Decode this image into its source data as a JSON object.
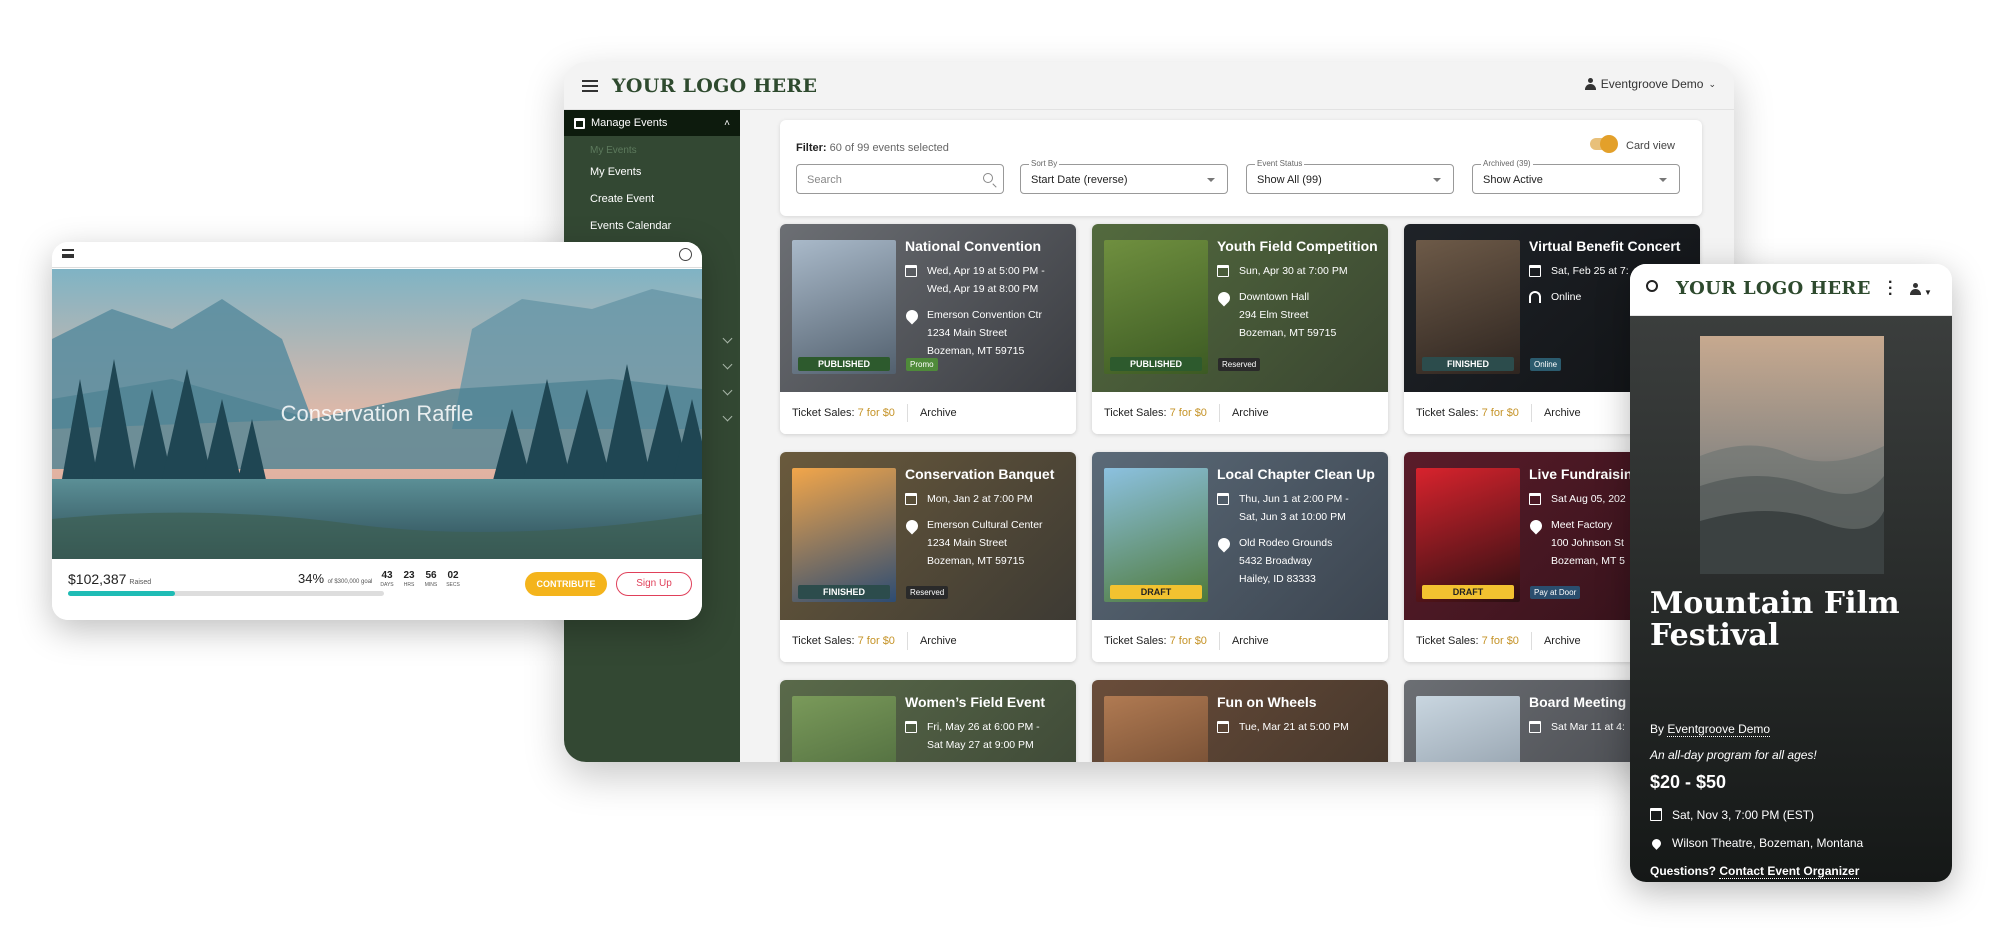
{
  "desktop": {
    "logo": "YOUR LOGO HERE",
    "user": "Eventgroove Demo",
    "sidebar": {
      "header": "Manage Events",
      "ghost_item": "My Events",
      "items": [
        "My Events",
        "Create Event",
        "Events Calendar"
      ]
    },
    "filter": {
      "label": "Filter:",
      "summary": "60 of 99 events selected",
      "card_view_label": "Card view",
      "search_placeholder": "Search",
      "sort_by": {
        "label": "Sort By",
        "value": "Start Date (reverse)"
      },
      "event_status": {
        "label": "Event Status",
        "value": "Show All (99)"
      },
      "archived": {
        "label": "Archived (39)",
        "value": "Show Active"
      }
    },
    "cards": [
      {
        "title": "National Convention",
        "date1": "Wed, Apr 19 at 5:00 PM -",
        "date2": "Wed, Apr 19 at 8:00 PM",
        "loc1": "Emerson Convention Ctr",
        "loc2": "1234 Main Street",
        "loc3": "Bozeman, MT 59715",
        "status": "PUBLISHED",
        "tag": "Promo",
        "tickets_label": "Ticket Sales:",
        "tickets_value": "7 for $0",
        "archive": "Archive"
      },
      {
        "title": "Youth Field Competition",
        "date1": "Sun, Apr 30 at 7:00 PM",
        "date2": "",
        "loc1": "Downtown Hall",
        "loc2": "294 Elm Street",
        "loc3": "Bozeman, MT 59715",
        "status": "PUBLISHED",
        "tag": "Reserved",
        "tickets_label": "Ticket Sales:",
        "tickets_value": "7 for $0",
        "archive": "Archive"
      },
      {
        "title": "Virtual Benefit Concert",
        "date1": "Sat, Feb 25 at 7:",
        "date2": "",
        "loc1": "Online",
        "loc2": "",
        "loc3": "",
        "status": "FINISHED",
        "tag": "Online",
        "tickets_label": "Ticket Sales:",
        "tickets_value": "7 for $0",
        "archive": "Archive"
      },
      {
        "title": "Conservation Banquet",
        "date1": "Mon, Jan 2 at 7:00 PM",
        "date2": "",
        "loc1": "Emerson Cultural Center",
        "loc2": "1234 Main Street",
        "loc3": "Bozeman, MT 59715",
        "status": "FINISHED",
        "tag": "Reserved",
        "tickets_label": "Ticket Sales:",
        "tickets_value": "7 for $0",
        "archive": "Archive"
      },
      {
        "title": "Local Chapter Clean Up",
        "date1": "Thu, Jun 1 at 2:00 PM -",
        "date2": "Sat, Jun 3 at 10:00 PM",
        "loc1": "Old Rodeo Grounds",
        "loc2": "5432 Broadway",
        "loc3": "Hailey, ID 83333",
        "status": "DRAFT",
        "tag": "",
        "tickets_label": "Ticket Sales:",
        "tickets_value": "7 for $0",
        "archive": "Archive"
      },
      {
        "title": "Live Fundraising",
        "date1": "Sat Aug 05, 202",
        "date2": "",
        "loc1": "Meet Factory",
        "loc2": "100 Johnson St",
        "loc3": "Bozeman, MT 5",
        "status": "DRAFT",
        "tag": "Pay at Door",
        "tickets_label": "Ticket Sales:",
        "tickets_value": "7 for $0",
        "archive": "Archive"
      },
      {
        "title": "Women’s Field Event",
        "date1": "Fri, May 26 at 6:00 PM -",
        "date2": "Sat May 27 at 9:00 PM",
        "loc1": "",
        "loc2": "",
        "loc3": "",
        "status": "",
        "tag": "",
        "tickets_label": "",
        "tickets_value": "",
        "archive": ""
      },
      {
        "title": "Fun on Wheels",
        "date1": "Tue, Mar 21 at 5:00 PM",
        "date2": "",
        "loc1": "",
        "loc2": "",
        "loc3": "",
        "status": "",
        "tag": "",
        "tickets_label": "",
        "tickets_value": "",
        "archive": ""
      },
      {
        "title": "Board Meeting",
        "date1": "Sat Mar 11 at 4:",
        "date2": "",
        "loc1": "",
        "loc2": "",
        "loc3": "",
        "status": "",
        "tag": "",
        "tickets_label": "",
        "tickets_value": "",
        "archive": ""
      }
    ]
  },
  "tablet": {
    "hero_title": "Conservation Raffle",
    "raised_amount": "$102,387",
    "raised_label": "Raised",
    "progress_percent": 34,
    "percent_text": "34%",
    "goal_text": "of $300,000 goal",
    "countdown": [
      {
        "value": "43",
        "unit": "DAYS"
      },
      {
        "value": "23",
        "unit": "HRS"
      },
      {
        "value": "56",
        "unit": "MINS"
      },
      {
        "value": "02",
        "unit": "SECS"
      }
    ],
    "contribute_label": "CONTRIBUTE",
    "signup_label": "Sign Up"
  },
  "phone": {
    "logo": "YOUR LOGO HERE",
    "title": "Mountain Film Festival",
    "by_label": "By",
    "organizer": "Eventgroove Demo",
    "tagline": "An all-day program for all ages!",
    "price": "$20 - $50",
    "date": "Sat, Nov 3, 7:00 PM (EST)",
    "venue": "Wilson Theatre, Bozeman, Montana",
    "questions_label": "Questions?",
    "contact_link": "Contact Event Organizer"
  },
  "colors": {
    "brand_green": "#2e4a2e",
    "sidebar": "#334833",
    "gold": "#c59327",
    "contribute": "#f4b41c",
    "signup": "#e0405a",
    "progress": "#1fbcb5"
  }
}
